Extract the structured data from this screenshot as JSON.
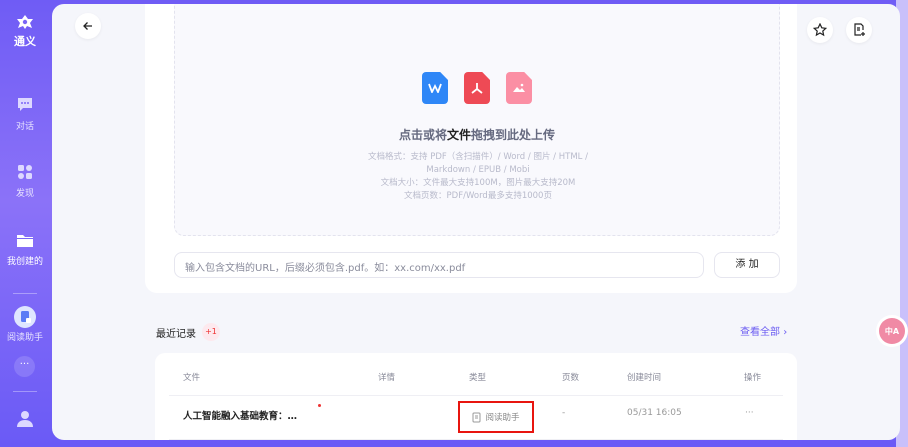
{
  "sidebar": {
    "logo": "通义",
    "items": [
      {
        "label": "对话"
      },
      {
        "label": "发现"
      },
      {
        "label": "我创建的"
      },
      {
        "label": "阅读助手"
      }
    ]
  },
  "upload": {
    "title_pre": "点击或将",
    "title_bold": "文件",
    "title_post": "拖拽到此处上传",
    "hints": [
      "文档格式：支持 PDF（含扫描件）/ Word / 图片 / HTML / Markdown / EPUB / Mobi",
      "文档大小：文件最大支持100M，图片最大支持20M",
      "文档页数：PDF/Word最多支持1000页"
    ],
    "url_placeholder": "输入包含文档的URL，后缀必须包含.pdf。如：xx.com/xx.pdf",
    "add_label": "添 加"
  },
  "recent": {
    "title": "最近记录",
    "badge": "+1",
    "view_all": "查看全部"
  },
  "table": {
    "headers": [
      "文件",
      "详情",
      "类型",
      "页数",
      "创建时间",
      "操作"
    ],
    "rows": [
      {
        "file": "人工智能融入基础教育：…",
        "type": "阅读助手",
        "pages": "-",
        "created": "05/31 16:05",
        "actions": "···"
      }
    ]
  },
  "translate_label": "中A"
}
